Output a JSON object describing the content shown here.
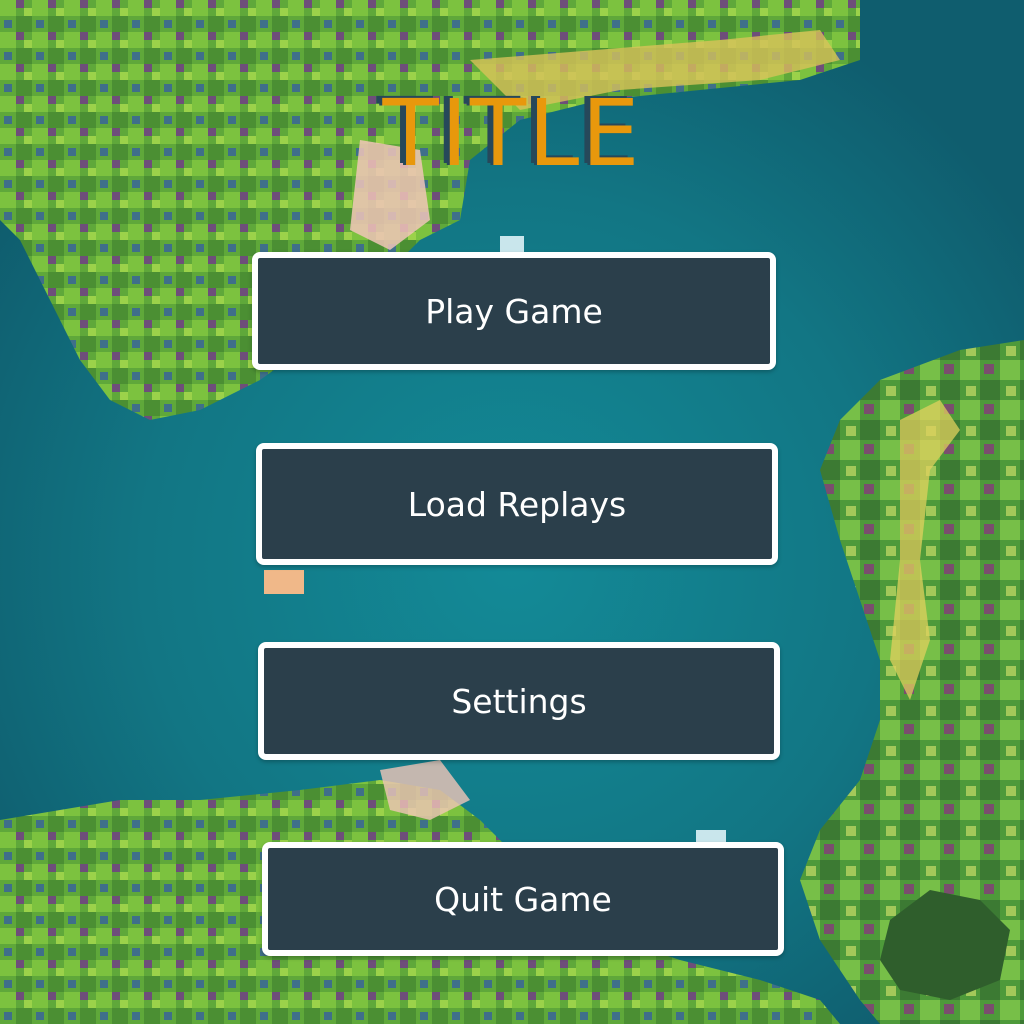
{
  "title": "TITLE",
  "menu": {
    "play": "Play Game",
    "load": "Load Replays",
    "settings": "Settings",
    "quit": "Quit Game"
  },
  "colors": {
    "title": "#e8980c",
    "title_shadow": "#26485a",
    "button_fill": "#2b3f4b",
    "button_border": "#ffffff",
    "water": "#1b7f8f"
  }
}
